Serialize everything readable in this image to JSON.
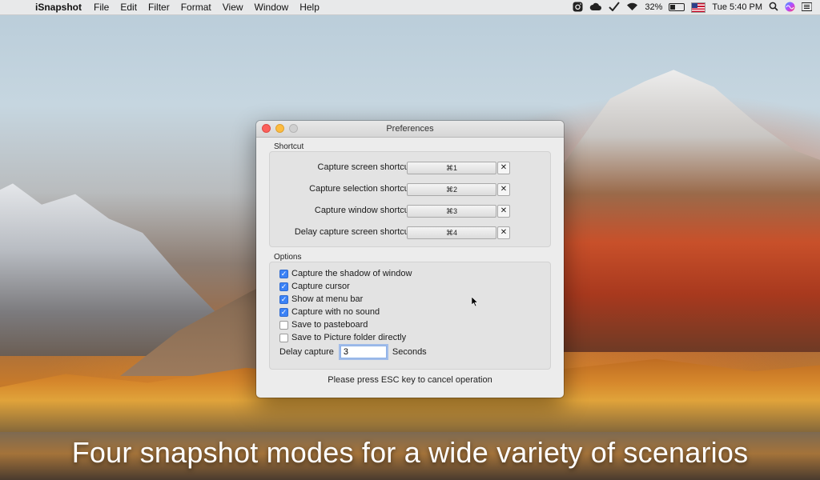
{
  "menubar": {
    "apple_glyph": "",
    "app_name": "iSnapshot",
    "items": [
      "File",
      "Edit",
      "Filter",
      "Format",
      "View",
      "Window",
      "Help"
    ],
    "status": {
      "battery_text": "32%",
      "battery_level": 0.32,
      "clock": "Tue 5:40 PM"
    },
    "icons": [
      "instagram-icon",
      "cloud-icon",
      "tick-icon",
      "wifi-icon",
      "battery-icon",
      "us-flag-icon",
      "search-icon",
      "siri-icon",
      "menu-list-icon"
    ]
  },
  "window": {
    "title": "Preferences",
    "shortcut_section": {
      "label": "Shortcut",
      "rows": [
        {
          "label": "Capture screen shortcut:",
          "value": "⌘1"
        },
        {
          "label": "Capture selection shortcut:",
          "value": "⌘2"
        },
        {
          "label": "Capture window shortcut:",
          "value": "⌘3"
        },
        {
          "label": "Delay capture screen shortcut:",
          "value": "⌘4"
        }
      ],
      "clear_glyph": "✕"
    },
    "options_section": {
      "label": "Options",
      "checkboxes": [
        {
          "label": "Capture the shadow of window",
          "checked": true
        },
        {
          "label": "Capture cursor",
          "checked": true
        },
        {
          "label": "Show at menu bar",
          "checked": true
        },
        {
          "label": "Capture with no sound",
          "checked": true
        },
        {
          "label": "Save to pasteboard",
          "checked": false
        },
        {
          "label": "Save to Picture folder directly",
          "checked": false
        }
      ],
      "delay_label": "Delay capture",
      "delay_value": "3",
      "delay_unit": "Seconds"
    },
    "footer_note": "Please press ESC key to cancel operation"
  },
  "caption": "Four snapshot modes for a wide variety of scenarios",
  "colors": {
    "checkbox_on": "#3b82f6",
    "close": "#fc605b",
    "minimize": "#fdbc40"
  }
}
